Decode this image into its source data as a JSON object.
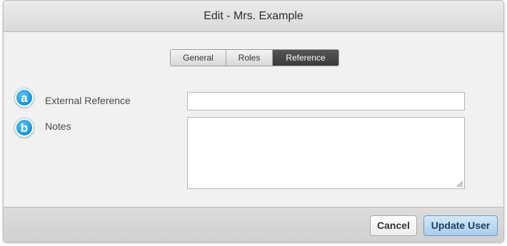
{
  "dialog": {
    "title": "Edit - Mrs. Example"
  },
  "tabs": [
    {
      "label": "General",
      "active": false
    },
    {
      "label": "Roles",
      "active": false
    },
    {
      "label": "Reference",
      "active": true
    }
  ],
  "fields": {
    "external_reference": {
      "marker": "a",
      "label": "External Reference",
      "value": "",
      "placeholder": ""
    },
    "notes": {
      "marker": "b",
      "label": "Notes",
      "value": "",
      "placeholder": ""
    }
  },
  "footer": {
    "cancel_label": "Cancel",
    "submit_label": "Update User"
  },
  "colors": {
    "marker_blue": "#1593d8",
    "active_tab": "#3b3b3b",
    "primary_button": "#a9cdee"
  },
  "icons": {
    "marker_a": "letter-a-circle-icon",
    "marker_b": "letter-b-circle-icon",
    "textarea_grip": "resize-grip-icon"
  }
}
